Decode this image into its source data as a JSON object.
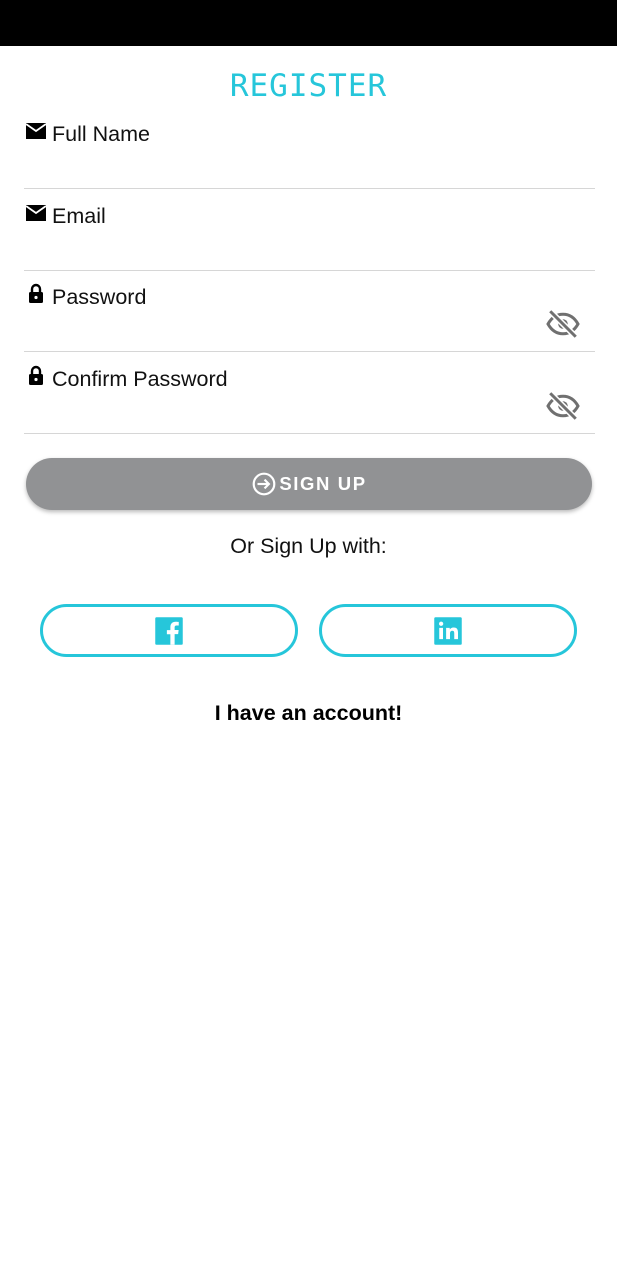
{
  "header": {
    "title": "REGISTER"
  },
  "form": {
    "full_name": {
      "placeholder": "Full Name",
      "icon": "mail-icon"
    },
    "email": {
      "placeholder": "Email",
      "icon": "mail-icon"
    },
    "password": {
      "placeholder": "Password",
      "icon": "lock-icon",
      "toggle_icon": "eye-off-icon"
    },
    "confirm_password": {
      "placeholder": "Confirm Password",
      "icon": "lock-icon",
      "toggle_icon": "eye-off-icon"
    }
  },
  "signup_button": {
    "label": "SIGN UP",
    "icon": "login-icon"
  },
  "social": {
    "prompt": "Or Sign Up with:",
    "providers": [
      {
        "name": "facebook",
        "icon": "facebook-icon"
      },
      {
        "name": "linkedin",
        "icon": "linkedin-icon"
      }
    ]
  },
  "footer": {
    "have_account_label": "I have an account!"
  },
  "colors": {
    "accent": "#26c6da",
    "button_disabled": "#919294",
    "divider": "#d6d6d6",
    "status_bar": "#000000"
  }
}
